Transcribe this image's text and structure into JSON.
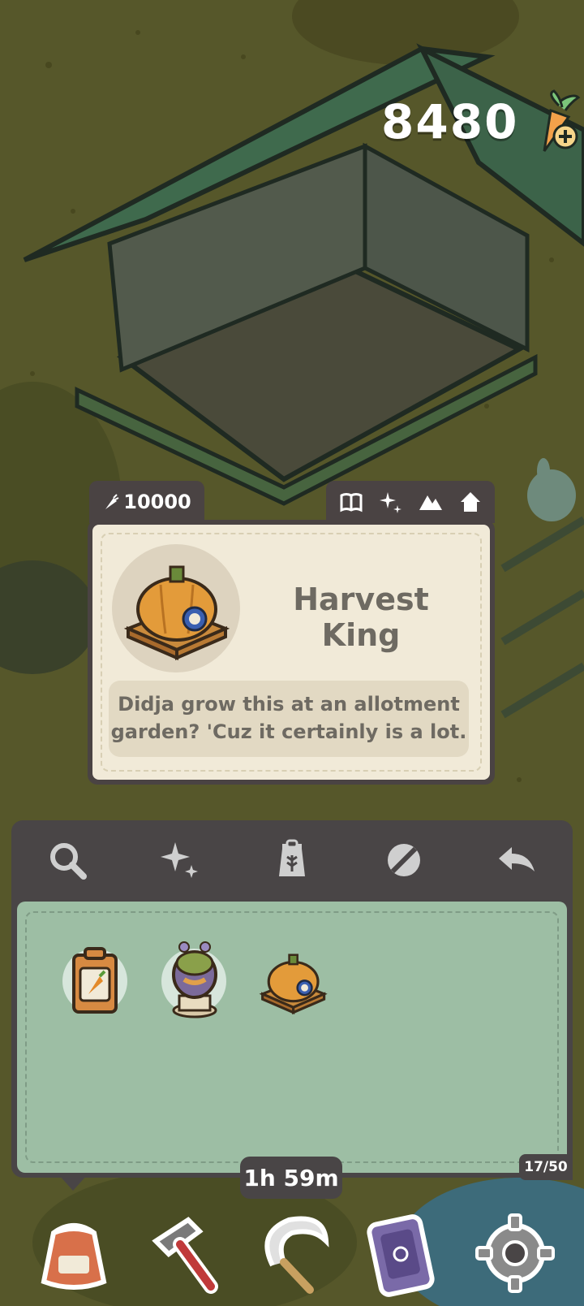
{
  "currency": {
    "value": "8480",
    "icon": "carrot-plus-icon"
  },
  "item_card": {
    "price": "10000",
    "price_icon": "carrot-icon",
    "category_icons": [
      "book-icon",
      "sparkle-icon",
      "mountain-icon",
      "house-icon"
    ],
    "title": "Harvest King",
    "description": "Didja grow this at an allotment garden? 'Cuz it certainly is a lot."
  },
  "inventory": {
    "tools": [
      "search-icon",
      "sparkle-icon",
      "seed-bag-icon",
      "eraser-icon",
      "back-arrow-icon"
    ],
    "items": [
      {
        "name": "carrot-seed-packet"
      },
      {
        "name": "mushroom-statue"
      },
      {
        "name": "harvest-king-pumpkin"
      }
    ],
    "count": "17/50"
  },
  "timer": "1h 59m",
  "nav": [
    {
      "name": "bag-button",
      "icon": "bag-icon"
    },
    {
      "name": "build-button",
      "icon": "hammer-icon"
    },
    {
      "name": "harvest-button",
      "icon": "sickle-icon"
    },
    {
      "name": "phone-button",
      "icon": "phone-icon"
    },
    {
      "name": "settings-button",
      "icon": "gear-icon"
    }
  ],
  "colors": {
    "panel": "#494546",
    "card": "#f1ead8",
    "grid": "#9dbea4",
    "ground": "#5a5a2a",
    "roof": "#3f6a4d"
  }
}
